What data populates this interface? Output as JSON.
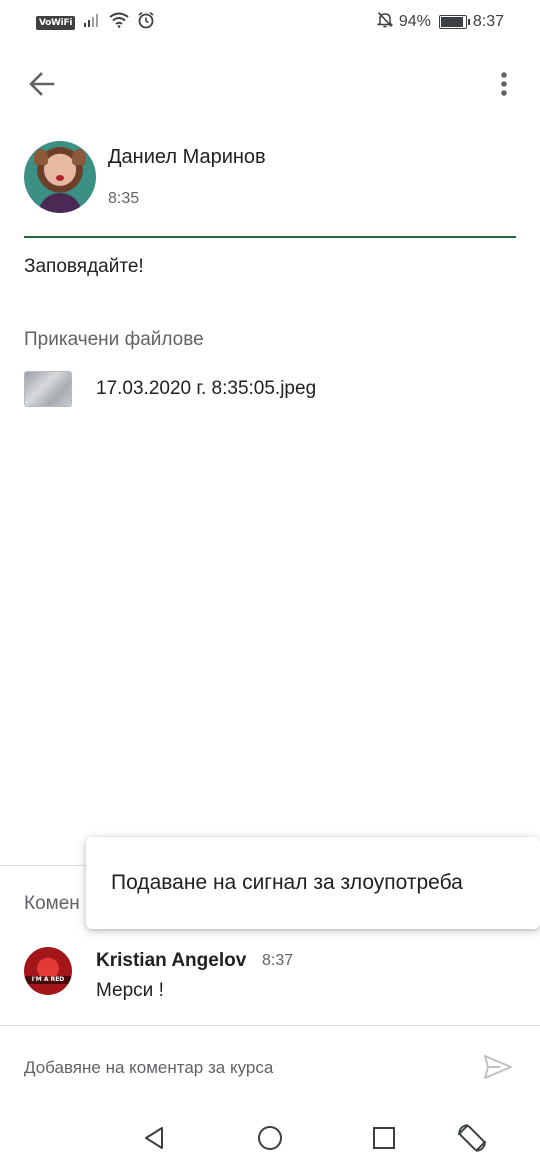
{
  "status_bar": {
    "vowifi_label": "VoWiFi",
    "battery_percent": "94%",
    "battery_level": 0.94,
    "time": "8:37"
  },
  "post": {
    "author": "Даниел Маринов",
    "time": "8:35",
    "text": "Заповядайте!",
    "attachments_heading": "Прикачени файлове",
    "attachments": [
      {
        "file_name": "17.03.2020 г. 8:35:05.jpeg"
      }
    ]
  },
  "comments": {
    "heading": "Комен",
    "items": [
      {
        "author": "Kristian Angelov",
        "time": "8:37",
        "text": "Мерси !",
        "avatar_text": "I'M A RED"
      }
    ]
  },
  "comment_input": {
    "placeholder": "Добавяне на коментар за курса"
  },
  "popup_menu": {
    "items": [
      {
        "label": "Подаване на сигнал за злоупотреба"
      }
    ]
  },
  "icons": {
    "back": "arrow-back-icon",
    "more": "more-vert-icon",
    "send": "send-icon",
    "nav_back": "triangle-back-icon",
    "nav_home": "circle-home-icon",
    "nav_recents": "square-recents-icon",
    "rotate": "screen-rotate-icon"
  },
  "colors": {
    "accent_green": "#1e6b3b",
    "text_primary": "#202124",
    "text_secondary": "#5f6368"
  }
}
